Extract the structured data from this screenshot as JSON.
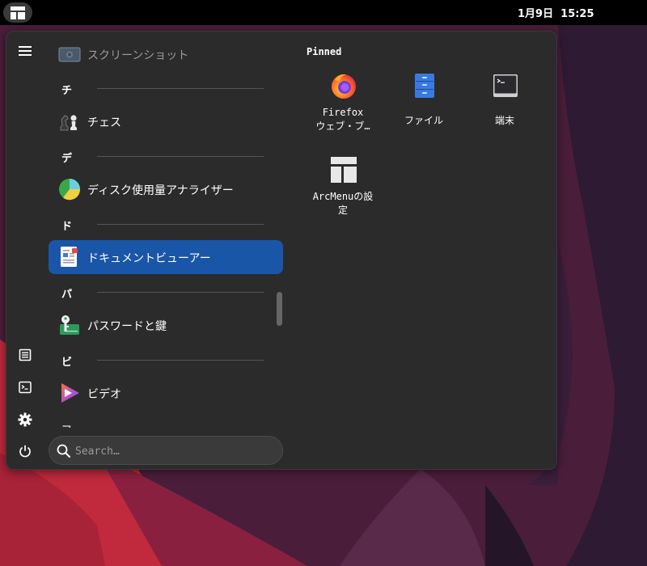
{
  "topbar": {
    "clock": "1月9日  15:25"
  },
  "sidebar": {
    "buttons": [
      {
        "icon": "hamburger-menu-icon"
      },
      {
        "icon": "document-icon"
      },
      {
        "icon": "terminal-icon"
      },
      {
        "icon": "gear-icon"
      },
      {
        "icon": "power-icon"
      }
    ]
  },
  "app_list": {
    "items": [
      {
        "type": "app",
        "label": "スクリーンショット",
        "icon": "screenshot-icon",
        "faded": true
      },
      {
        "type": "header",
        "label": "チ"
      },
      {
        "type": "app",
        "label": "チェス",
        "icon": "chess-icon"
      },
      {
        "type": "header",
        "label": "デ"
      },
      {
        "type": "app",
        "label": "ディスク使用量アナライザー",
        "icon": "disk-usage-icon"
      },
      {
        "type": "header",
        "label": "ド"
      },
      {
        "type": "app",
        "label": "ドキュメントビューアー",
        "icon": "document-viewer-icon",
        "selected": true
      },
      {
        "type": "header",
        "label": "パ"
      },
      {
        "type": "app",
        "label": "パスワードと鍵",
        "icon": "passwords-keys-icon"
      },
      {
        "type": "header",
        "label": "ビ"
      },
      {
        "type": "app",
        "label": "ビデオ",
        "icon": "video-icon"
      },
      {
        "type": "header",
        "label": "フ"
      }
    ]
  },
  "search": {
    "placeholder": "Search…"
  },
  "pinned": {
    "title": "Pinned",
    "items": [
      {
        "line1": "Firefox",
        "line2": "ウェブ・ブ…",
        "icon": "firefox-icon"
      },
      {
        "line1": "ファイル",
        "line2": "",
        "icon": "files-icon"
      },
      {
        "line1": "端末",
        "line2": "",
        "icon": "terminal-icon"
      },
      {
        "line1": "ArcMenuの設",
        "line2": "定",
        "icon": "arcmenu-settings-icon"
      }
    ]
  },
  "colors": {
    "selected": "#1a56a8",
    "panel": "#2b2b2b",
    "topbar": "#000000"
  }
}
